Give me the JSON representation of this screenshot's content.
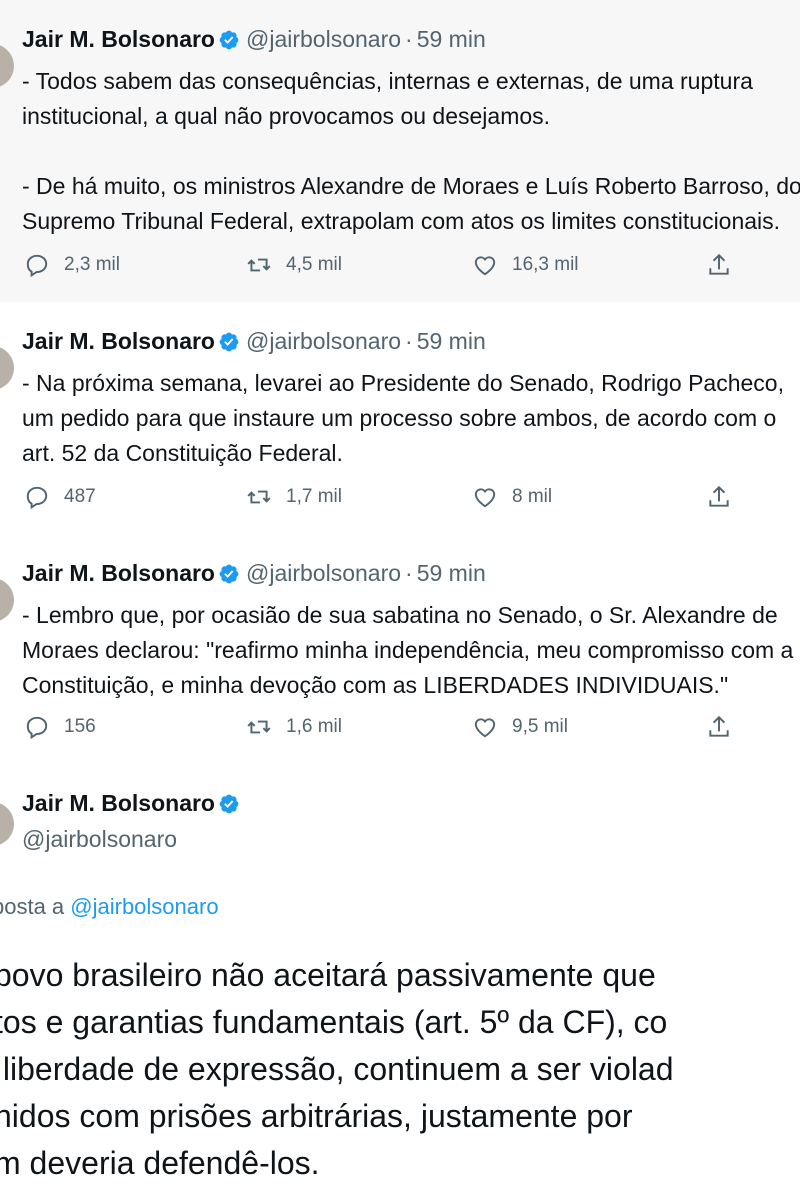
{
  "tweets": [
    {
      "name": "Jair M. Bolsonaro",
      "handle": "@jairbolsonaro",
      "time": "59 min",
      "text": "- Todos sabem das consequências, internas e externas, de uma ruptura\ninstitucional, a qual não provocamos ou desejamos.\n\n- De há muito, os ministros Alexandre de Moraes e Luís Roberto Barroso, do\nSupremo Tribunal Federal, extrapolam com atos os limites constitucionais.",
      "replies": "2,3 mil",
      "retweets": "4,5 mil",
      "likes": "16,3 mil"
    },
    {
      "name": "Jair M. Bolsonaro",
      "handle": "@jairbolsonaro",
      "time": "59 min",
      "text": "- Na próxima semana, levarei ao Presidente do Senado, Rodrigo Pacheco,\num pedido para que instaure um processo sobre ambos, de acordo com o\nart. 52 da Constituição Federal.",
      "replies": "487",
      "retweets": "1,7 mil",
      "likes": "8 mil"
    },
    {
      "name": "Jair M. Bolsonaro",
      "handle": "@jairbolsonaro",
      "time": "59 min",
      "text": "- Lembro que, por ocasião de sua sabatina no Senado, o Sr. Alexandre de\nMoraes declarou: \"reafirmo minha independência, meu compromisso com a\nConstituição, e minha devoção com as LIBERDADES INDIVIDUAIS.\"",
      "replies": "156",
      "retweets": "1,6 mil",
      "likes": "9,5 mil"
    }
  ],
  "main": {
    "name": "Jair M. Bolsonaro",
    "handle": "@jairbolsonaro",
    "replying_prefix": "posta a ",
    "replying_to": "@jairbolsonaro",
    "text": "povo brasileiro não aceitará passivamente que\ntos e garantias fundamentais (art. 5º da CF), co\n liberdade de expressão, continuem a ser violad\nnidos com prisões arbitrárias, justamente por\nm deveria defendê-los."
  },
  "colors": {
    "accent": "#1d9bf0",
    "muted": "#536471",
    "text": "#0f1419",
    "highlight_bg": "#f7f7f7"
  },
  "icons": [
    "verified-badge-icon",
    "reply-icon",
    "retweet-icon",
    "like-icon",
    "share-icon"
  ]
}
